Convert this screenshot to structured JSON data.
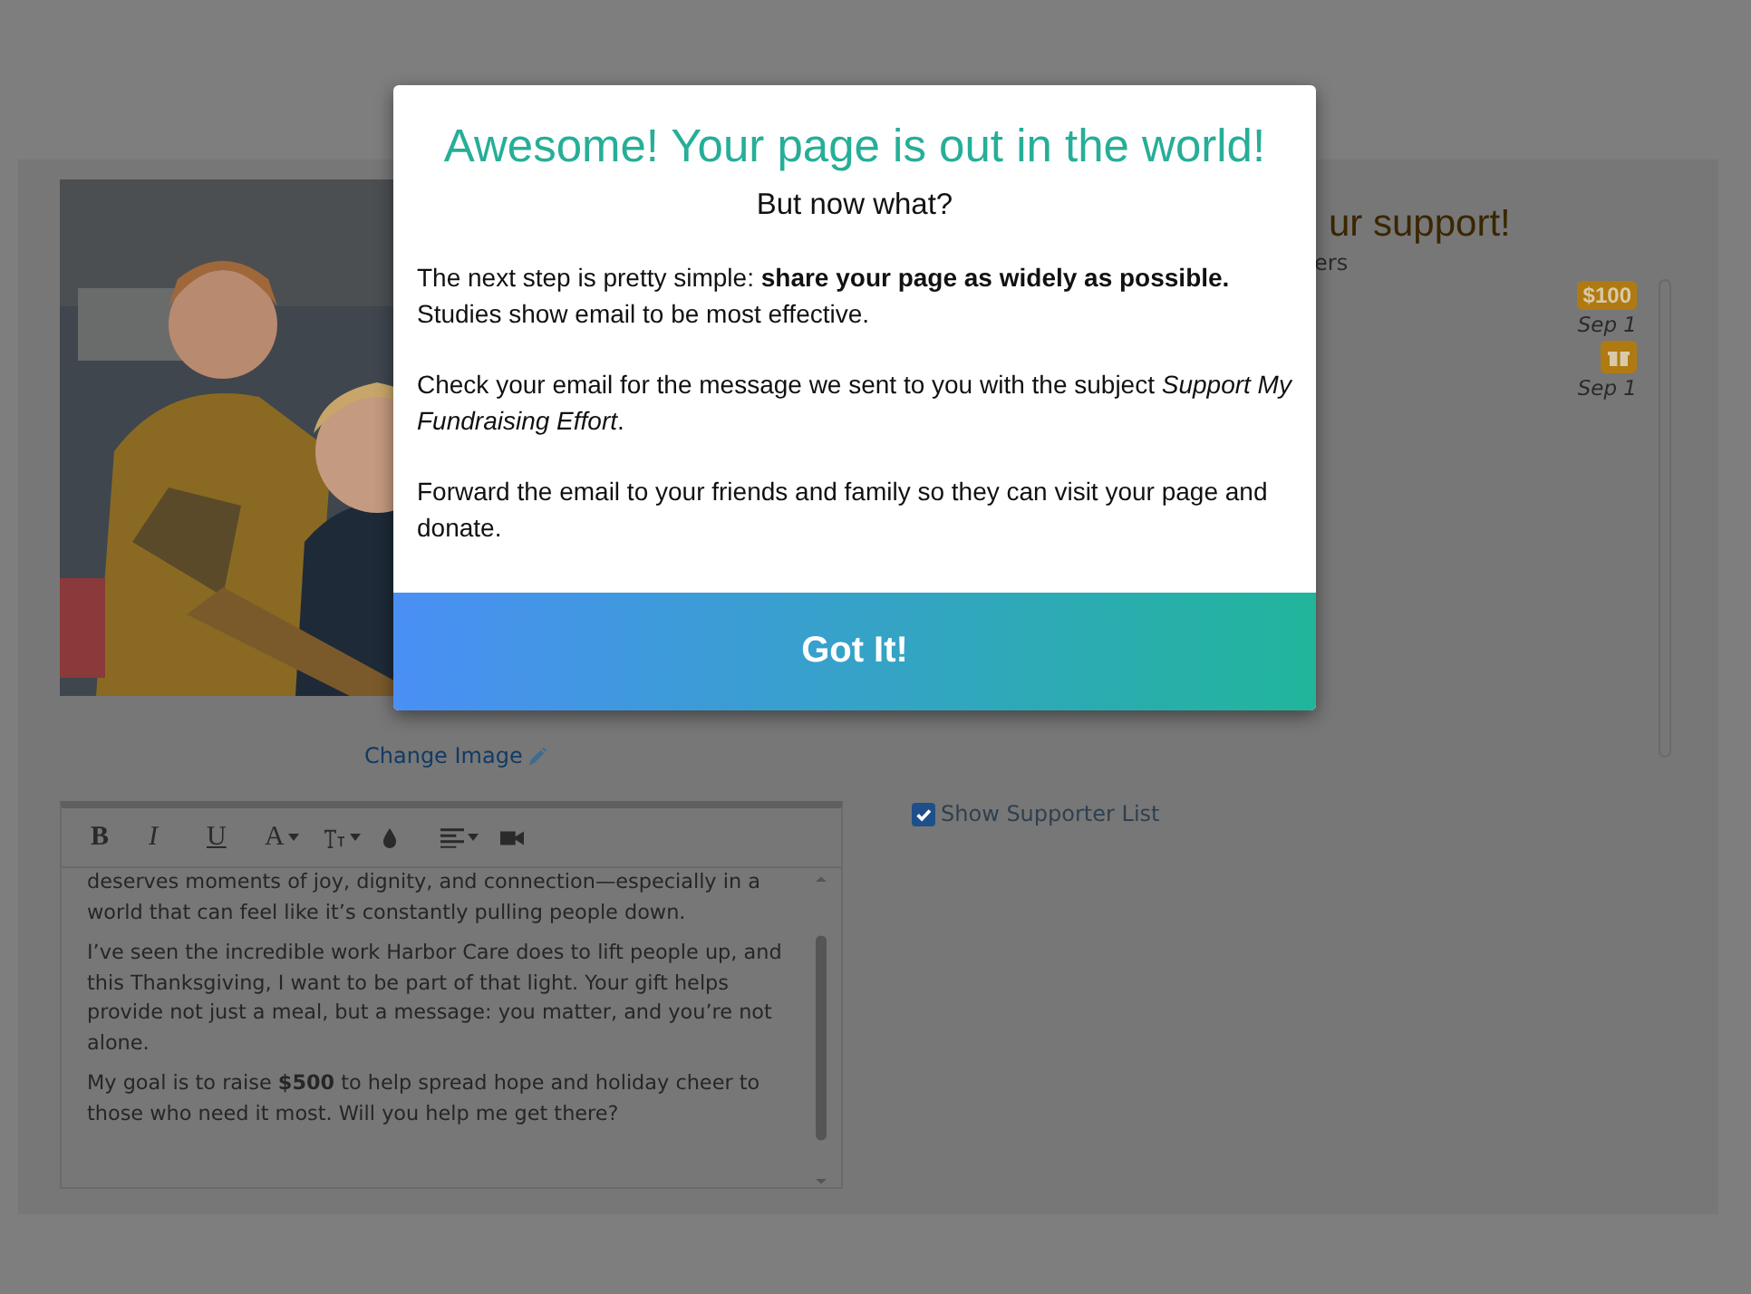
{
  "modal": {
    "title": "Awesome! Your page is out in the world!",
    "subtitle": "But now what?",
    "paragraphs": [
      "The next step is pretty simple: **share your page as widely as possible.** Studies show email to be most effective.",
      "Check your email for the message we sent to you with the subject *Support My Fundraising Effort*.",
      "Forward the email to your friends and family so they can visit your page and donate."
    ],
    "button": "Got It!"
  },
  "change_image_link": "Change Image",
  "editor": {
    "toolbar": [
      {
        "kind": "bold",
        "label": "B"
      },
      {
        "kind": "italic",
        "label": "I"
      },
      {
        "kind": "underline",
        "label": "U"
      },
      {
        "kind": "font",
        "label": "A"
      },
      {
        "kind": "size"
      },
      {
        "kind": "color"
      },
      {
        "kind": "align"
      },
      {
        "kind": "video"
      }
    ],
    "paragraphs": [
      "deserves moments of joy, dignity, and connection—especially in a world that can feel like it’s constantly pulling people down.",
      "I’ve seen the incredible work Harbor Care does to lift people up, and this Thanksgiving, I want to be part of that light. Your gift helps provide not just a meal, but a message: you matter, and you’re not alone.",
      "My goal is to raise **$500** to help spread hope and holiday cheer to those who need it most. Will you help me get there?"
    ]
  },
  "support": {
    "heading": "ur support!",
    "count_text": "ers",
    "donations": [
      {
        "kind": "amount",
        "label": "$100",
        "date": "Sep 1"
      },
      {
        "kind": "gift",
        "date": "Sep 1"
      }
    ]
  },
  "show_supporter_list": {
    "label": "Show Supporter List",
    "checked": true
  }
}
